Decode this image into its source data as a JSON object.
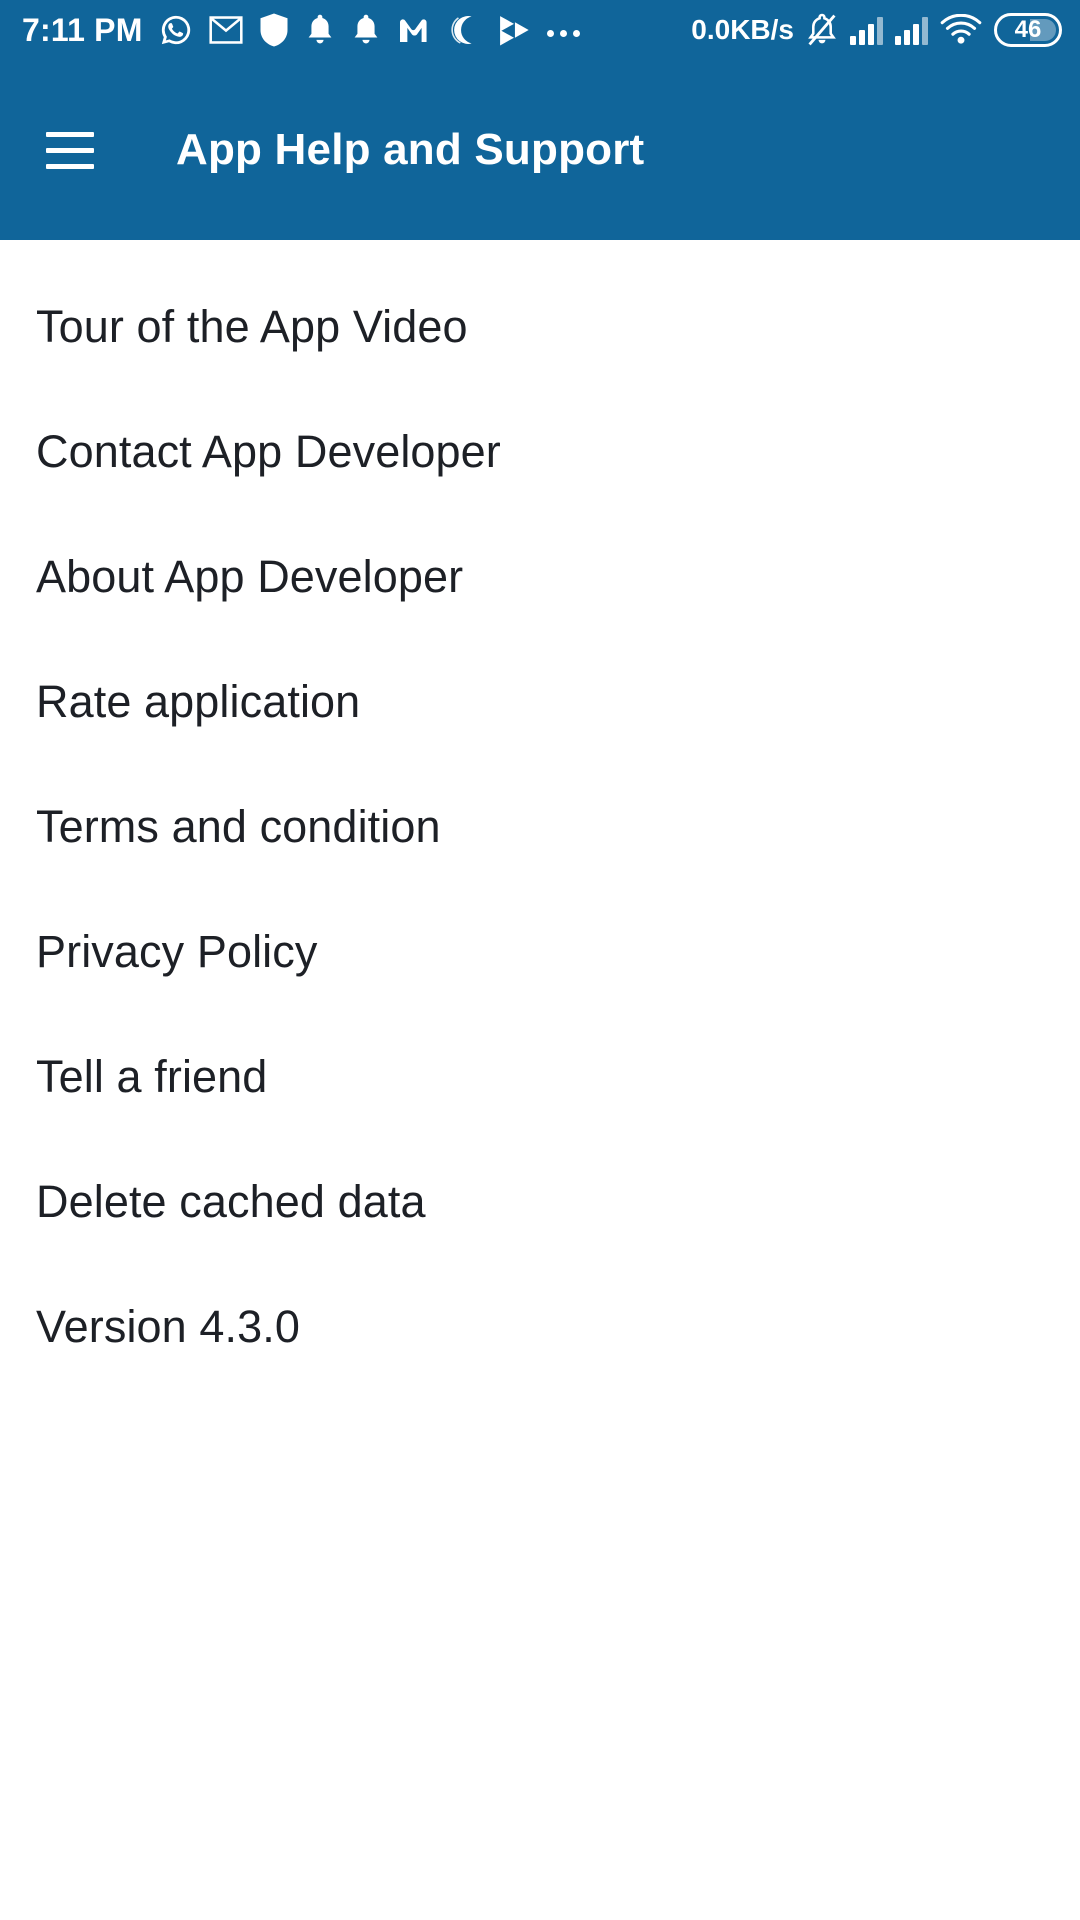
{
  "status_bar": {
    "time": "7:11 PM",
    "network_speed": "0.0KB/s",
    "battery_level": "46",
    "background_color": "#10659A",
    "left_icons": [
      "whatsapp-icon",
      "email-icon",
      "shield-icon",
      "notification-bell-icon",
      "alarm-bell-icon",
      "m-app-icon",
      "do-not-disturb-moon-icon",
      "media-play-icon",
      "more-dots-icon"
    ],
    "right_icons": [
      "silent-bell-icon",
      "signal-bars-sim1-icon",
      "signal-bars-sim2-icon",
      "wifi-icon",
      "battery-icon"
    ]
  },
  "app_bar": {
    "menu_icon": "hamburger-menu-icon",
    "title": "App Help and Support",
    "background_color": "#10659A",
    "text_color": "#FFFFFF"
  },
  "menu": {
    "text_color": "#1D2026",
    "items": [
      {
        "label": "Tour of the App Video"
      },
      {
        "label": "Contact App Developer"
      },
      {
        "label": "About App Developer"
      },
      {
        "label": "Rate application"
      },
      {
        "label": "Terms and condition"
      },
      {
        "label": "Privacy Policy"
      },
      {
        "label": "Tell a friend"
      },
      {
        "label": "Delete cached data"
      },
      {
        "label": "Version 4.3.0"
      }
    ]
  }
}
